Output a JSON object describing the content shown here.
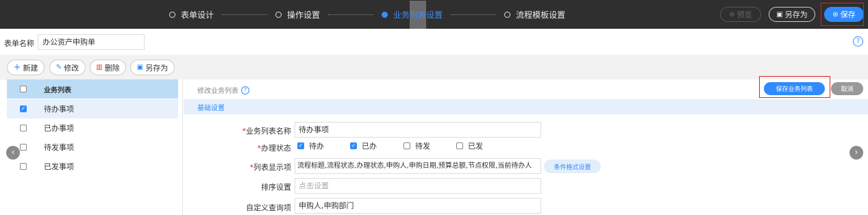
{
  "steps": [
    {
      "label": "表单设计",
      "active": false
    },
    {
      "label": "操作设置",
      "active": false
    },
    {
      "label_a": "业务",
      "label_b": "列表",
      "label_c": "设置",
      "active": true
    },
    {
      "label": "流程模板设置",
      "active": false
    }
  ],
  "toolbar_top": {
    "preview": "预览",
    "save_as": "另存为",
    "save": "保存"
  },
  "form_name": {
    "label": "表单名称",
    "value": "办公资产申购单"
  },
  "actions": {
    "new": "新建",
    "edit": "修改",
    "delete": "删除",
    "save_as": "另存为"
  },
  "list": {
    "header": "业务列表",
    "items": [
      {
        "label": "待办事项",
        "checked": true
      },
      {
        "label": "已办事项",
        "checked": false
      },
      {
        "label": "待发事项",
        "checked": false
      },
      {
        "label": "已发事项",
        "checked": false
      }
    ]
  },
  "edit_panel": {
    "title": "修改业务列表",
    "save_button": "保存业务列表",
    "cancel_button": "取消",
    "section_title": "基础设置",
    "fields": {
      "name_label": "业务列表名称",
      "name_value": "待办事项",
      "status_label": "办理状态",
      "status_options": [
        {
          "label": "待办",
          "checked": true
        },
        {
          "label": "已办",
          "checked": true
        },
        {
          "label": "待发",
          "checked": false
        },
        {
          "label": "已发",
          "checked": false
        }
      ],
      "columns_label": "列表显示项",
      "columns_value": "流程标题,流程状态,办理状态,申购人,申购日期,预算总额,节点权限,当前待办人",
      "cond_format_button": "条件格式设置",
      "sort_label": "排序设置",
      "sort_placeholder": "点击设置",
      "query_label": "自定义查询项",
      "query_value": "申购人,申购部门"
    }
  },
  "colors": {
    "accent": "#2f8bff",
    "topbar": "#2f2f2f",
    "highlight_box": "#e02020"
  },
  "icons": [
    "plus-icon",
    "edit-icon",
    "trash-icon",
    "save-icon",
    "preview-icon",
    "help-icon",
    "chevron-left-icon",
    "chevron-right-icon"
  ]
}
